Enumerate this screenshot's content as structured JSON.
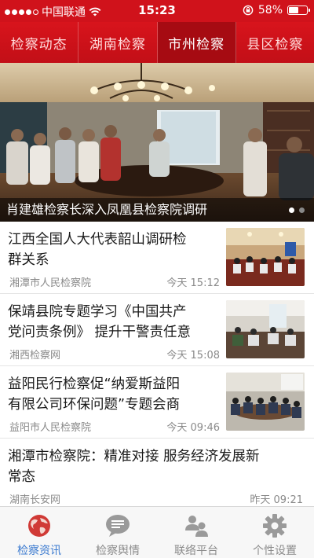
{
  "status_bar": {
    "carrier": "中国联通",
    "time": "15:23",
    "battery": "58%",
    "battery_level": 0.58,
    "icons": [
      "signal-icon",
      "wifi-icon",
      "rotation-lock-icon",
      "battery-icon"
    ]
  },
  "tabs": [
    {
      "label": "检察动态",
      "active": false
    },
    {
      "label": "湖南检察",
      "active": false
    },
    {
      "label": "市州检察",
      "active": true
    },
    {
      "label": "县区检察",
      "active": false
    }
  ],
  "banner": {
    "caption": "肖建雄检察长深入凤凰县检察院调研",
    "slide_count": 2,
    "active_slide": 1
  },
  "news": [
    {
      "title": "江西全国人大代表韶山调研检\n群关系",
      "source": "湘潭市人民检察院",
      "time": "今天 15:12",
      "has_thumb": true
    },
    {
      "title": "保靖县院专题学习《中国共产\n党问责条例》 提升干警责任意",
      "source": "湘西检察网",
      "time": "今天 15:08",
      "has_thumb": true
    },
    {
      "title": "益阳民行检察促“纳爱斯益阳\n有限公司环保问题”专题会商",
      "source": "益阳市人民检察院",
      "time": "今天 09:46",
      "has_thumb": true
    },
    {
      "title": "湘潭市检察院：精准对接 服务经济发展新\n常态",
      "source": "湖南长安网",
      "time": "昨天 09:21",
      "has_thumb": false
    }
  ],
  "bottom_nav": [
    {
      "label": "检察资讯",
      "icon": "globe-icon",
      "active": true
    },
    {
      "label": "检察舆情",
      "icon": "chat-bubble-icon",
      "active": false
    },
    {
      "label": "联络平台",
      "icon": "contacts-icon",
      "active": false
    },
    {
      "label": "个性设置",
      "icon": "gear-icon",
      "active": false
    }
  ],
  "colors": {
    "brand_red": "#d0121b",
    "active_tab": "#a60b12",
    "active_nav": "#3c7bd0"
  }
}
